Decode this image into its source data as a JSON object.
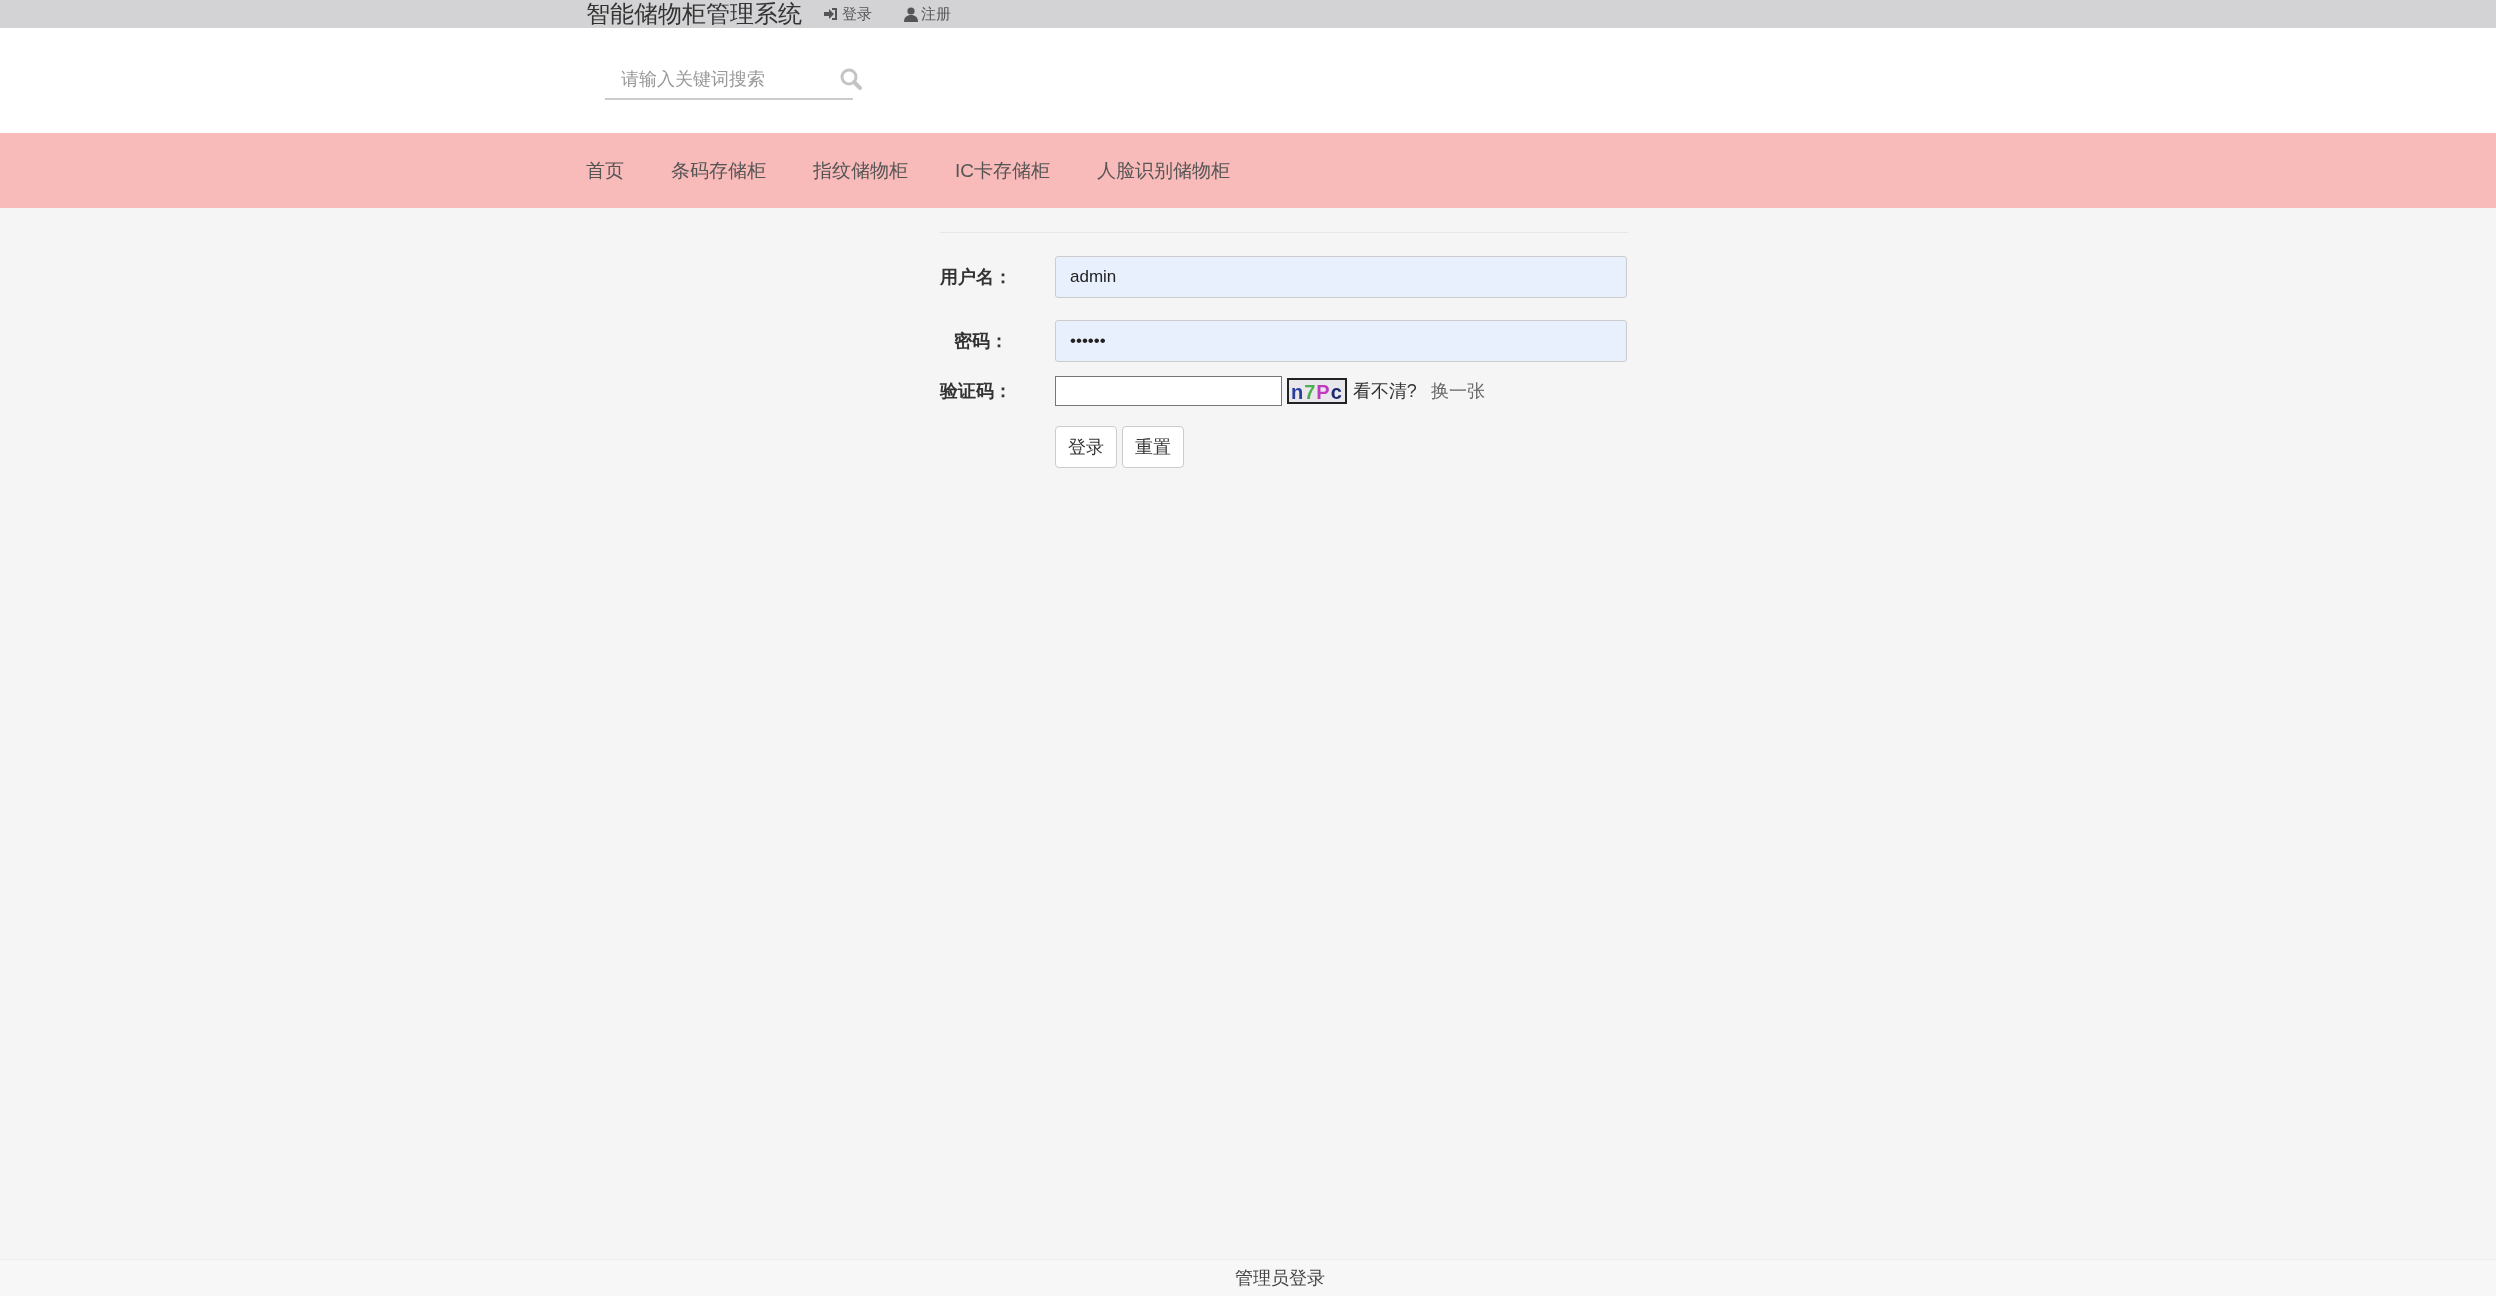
{
  "header": {
    "title": "智能储物柜管理系统",
    "links": [
      {
        "kind": "login",
        "label": "登录"
      },
      {
        "kind": "register",
        "label": "注册"
      }
    ]
  },
  "search": {
    "placeholder": "请输入关键词搜索"
  },
  "nav": [
    {
      "label": "首页"
    },
    {
      "label": "条码存储柜"
    },
    {
      "label": "指纹储物柜"
    },
    {
      "label": "IC卡存储柜"
    },
    {
      "label": "人脸识别储物柜"
    }
  ],
  "form": {
    "fields": [
      {
        "kind": "text",
        "label": "用户名：",
        "value": "admin"
      },
      {
        "kind": "password",
        "label": "密码：",
        "value": "••••••"
      },
      {
        "kind": "captcha",
        "label": "验证码：",
        "code": "n7Pc",
        "hint": "看不清?",
        "refresh": "换一张"
      }
    ],
    "buttons": [
      "登录",
      "重置"
    ]
  },
  "footer": {
    "link": "管理员登录"
  }
}
